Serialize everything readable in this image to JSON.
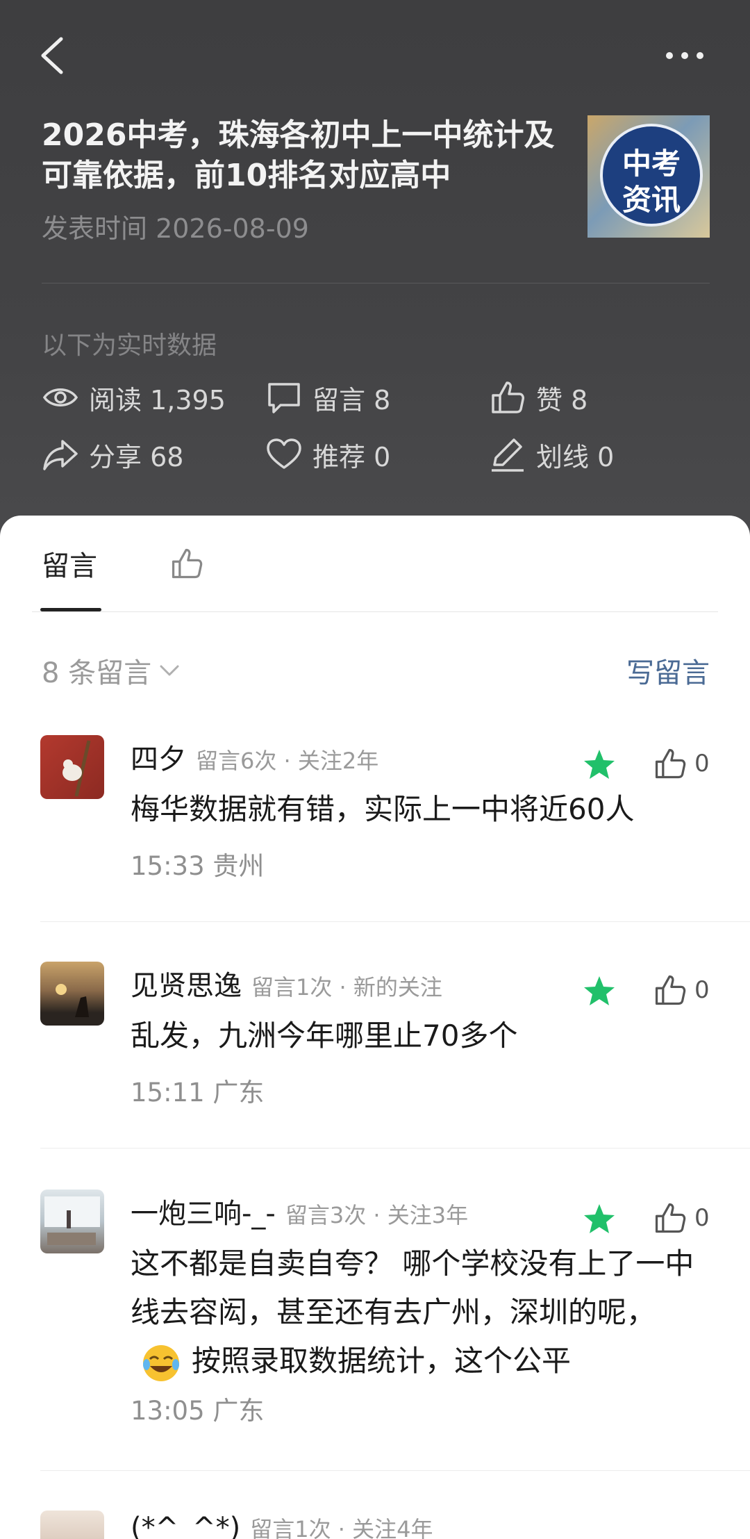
{
  "article": {
    "title": "2026中考，珠海各初中上一中统计及可靠依据，前10排名对应高中",
    "date": "发表时间 2026-08-09",
    "thumb_line1": "中考",
    "thumb_line2": "资讯"
  },
  "stats": {
    "section_label": "以下为实时数据",
    "items": [
      {
        "icon": "eye-icon",
        "label": "阅读 1,395"
      },
      {
        "icon": "comment-icon",
        "label": "留言 8"
      },
      {
        "icon": "thumbs-up-icon",
        "label": "赞 8"
      },
      {
        "icon": "share-icon",
        "label": "分享 68"
      },
      {
        "icon": "heart-icon",
        "label": "推荐 0"
      },
      {
        "icon": "pen-icon",
        "label": "划线 0"
      }
    ]
  },
  "tabs": {
    "comments_label": "留言"
  },
  "comments_header": {
    "count_label": "8 条留言",
    "write_label": "写留言"
  },
  "comments": [
    {
      "name": "四夕",
      "meta": "留言6次 · 关注2年",
      "text": "梅华数据就有错，实际上一中将近60人",
      "time": "15:33  贵州",
      "likes": "0"
    },
    {
      "name": "见贤思逸",
      "meta": "留言1次 · 新的关注",
      "text": "乱发，九洲今年哪里止70多个",
      "time": "15:11  广东",
      "likes": "0"
    },
    {
      "name": "一炮三响-_-",
      "meta": "留言3次 · 关注3年",
      "text_part1": "这不都是自卖自夸？  哪个学校没有上了一中线去容闳，甚至还有去广州，深圳的呢，",
      "text_part2": "按照录取数据统计，这个公平",
      "time": "13:05  广东",
      "likes": "0"
    },
    {
      "name": "(*^_^*)",
      "meta": "留言1次 · 关注4年"
    }
  ]
}
